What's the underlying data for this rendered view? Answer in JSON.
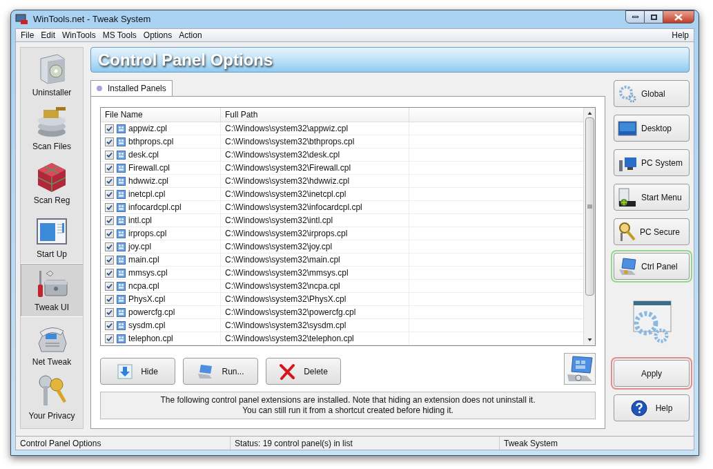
{
  "window": {
    "title": "WinTools.net - Tweak System"
  },
  "menu": {
    "items": [
      "File",
      "Edit",
      "WinTools",
      "MS Tools",
      "Options",
      "Action"
    ],
    "help": "Help"
  },
  "sidebar": {
    "items": [
      {
        "label": "Uninstaller",
        "selected": false
      },
      {
        "label": "Scan Files",
        "selected": false
      },
      {
        "label": "Scan Reg",
        "selected": false
      },
      {
        "label": "Start Up",
        "selected": false
      },
      {
        "label": "Tweak UI",
        "selected": true
      },
      {
        "label": "Net Tweak",
        "selected": false
      },
      {
        "label": "Your Privacy",
        "selected": false
      }
    ]
  },
  "banner": {
    "title": "Control Panel Options"
  },
  "tabs": [
    {
      "label": "Installed Panels",
      "selected": true
    }
  ],
  "table": {
    "columns": [
      "File Name",
      "Full Path"
    ],
    "rows": [
      {
        "checked": true,
        "file": "appwiz.cpl",
        "path": "C:\\Windows\\system32\\appwiz.cpl"
      },
      {
        "checked": true,
        "file": "bthprops.cpl",
        "path": "C:\\Windows\\system32\\bthprops.cpl"
      },
      {
        "checked": true,
        "file": "desk.cpl",
        "path": "C:\\Windows\\system32\\desk.cpl"
      },
      {
        "checked": true,
        "file": "Firewall.cpl",
        "path": "C:\\Windows\\system32\\Firewall.cpl"
      },
      {
        "checked": true,
        "file": "hdwwiz.cpl",
        "path": "C:\\Windows\\system32\\hdwwiz.cpl"
      },
      {
        "checked": true,
        "file": "inetcpl.cpl",
        "path": "C:\\Windows\\system32\\inetcpl.cpl"
      },
      {
        "checked": true,
        "file": "infocardcpl.cpl",
        "path": "C:\\Windows\\system32\\infocardcpl.cpl"
      },
      {
        "checked": true,
        "file": "intl.cpl",
        "path": "C:\\Windows\\system32\\intl.cpl"
      },
      {
        "checked": true,
        "file": "irprops.cpl",
        "path": "C:\\Windows\\system32\\irprops.cpl"
      },
      {
        "checked": true,
        "file": "joy.cpl",
        "path": "C:\\Windows\\system32\\joy.cpl"
      },
      {
        "checked": true,
        "file": "main.cpl",
        "path": "C:\\Windows\\system32\\main.cpl"
      },
      {
        "checked": true,
        "file": "mmsys.cpl",
        "path": "C:\\Windows\\system32\\mmsys.cpl"
      },
      {
        "checked": true,
        "file": "ncpa.cpl",
        "path": "C:\\Windows\\system32\\ncpa.cpl"
      },
      {
        "checked": true,
        "file": "PhysX.cpl",
        "path": "C:\\Windows\\system32\\PhysX.cpl"
      },
      {
        "checked": true,
        "file": "powercfg.cpl",
        "path": "C:\\Windows\\system32\\powercfg.cpl"
      },
      {
        "checked": true,
        "file": "sysdm.cpl",
        "path": "C:\\Windows\\system32\\sysdm.cpl"
      },
      {
        "checked": true,
        "file": "telephon.cpl",
        "path": "C:\\Windows\\system32\\telephon.cpl"
      }
    ]
  },
  "actions": [
    {
      "label": "Hide",
      "kind": "hide"
    },
    {
      "label": "Run...",
      "kind": "run"
    },
    {
      "label": "Delete",
      "kind": "delete"
    }
  ],
  "info": {
    "lines": [
      "The following control panel extensions are installed. Note that hiding an extension does not uninstall it.",
      "You can still run it from a shortcut created before hiding it."
    ]
  },
  "categories": [
    {
      "label": "Global",
      "selected": false
    },
    {
      "label": "Desktop",
      "selected": false
    },
    {
      "label": "PC System",
      "selected": false
    },
    {
      "label": "Start Menu",
      "selected": false
    },
    {
      "label": "PC Secure",
      "selected": false
    },
    {
      "label": "Ctrl Panel",
      "selected": true
    }
  ],
  "commands": [
    {
      "label": "Apply",
      "kind": "apply"
    },
    {
      "label": "Help",
      "kind": "help"
    }
  ],
  "status_bar": [
    "Control Panel Options",
    "Status: 19 control panel(s) in list",
    "Tweak System"
  ]
}
